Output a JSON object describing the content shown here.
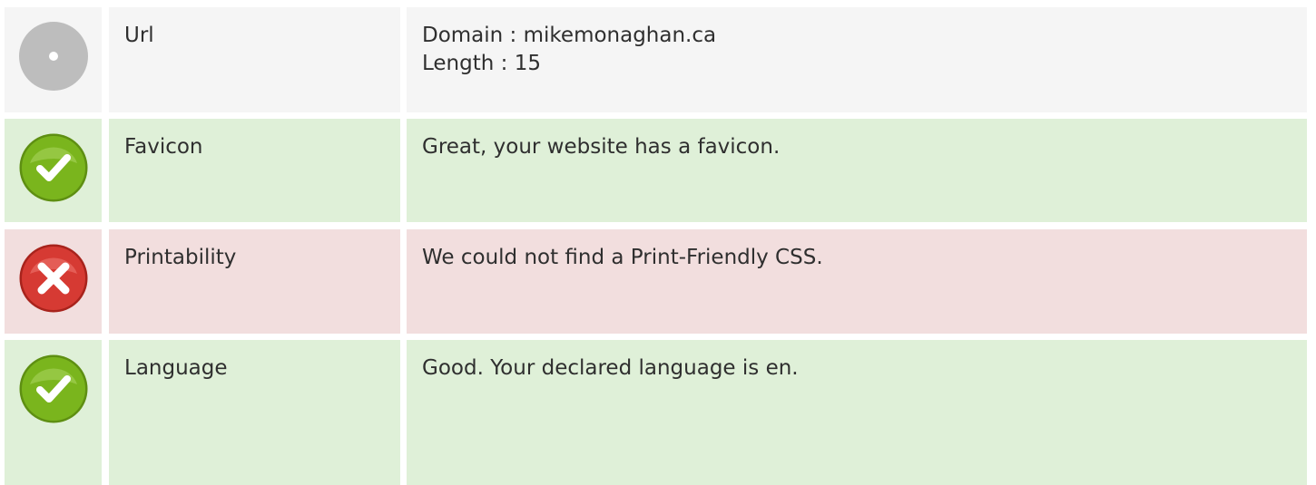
{
  "rows": [
    {
      "status": "neutral",
      "icon": "info-circle-icon",
      "label": "Url",
      "lines": [
        "Domain : mikemonaghan.ca",
        "Length : 15"
      ]
    },
    {
      "status": "pass",
      "icon": "checkmark-icon",
      "label": "Favicon",
      "lines": [
        "Great, your website has a favicon."
      ]
    },
    {
      "status": "fail",
      "icon": "cross-icon",
      "label": "Printability",
      "lines": [
        "We could not find a Print-Friendly CSS."
      ]
    },
    {
      "status": "pass",
      "icon": "checkmark-icon",
      "label": "Language",
      "lines": [
        "Good. Your declared language is en."
      ]
    }
  ],
  "colors": {
    "neutral_bg": "#f5f5f5",
    "pass_bg": "#dff0d8",
    "fail_bg": "#f2dede",
    "pass_icon": "#7ab51d",
    "fail_icon": "#d63a33",
    "neutral_icon": "#bdbdbd"
  }
}
